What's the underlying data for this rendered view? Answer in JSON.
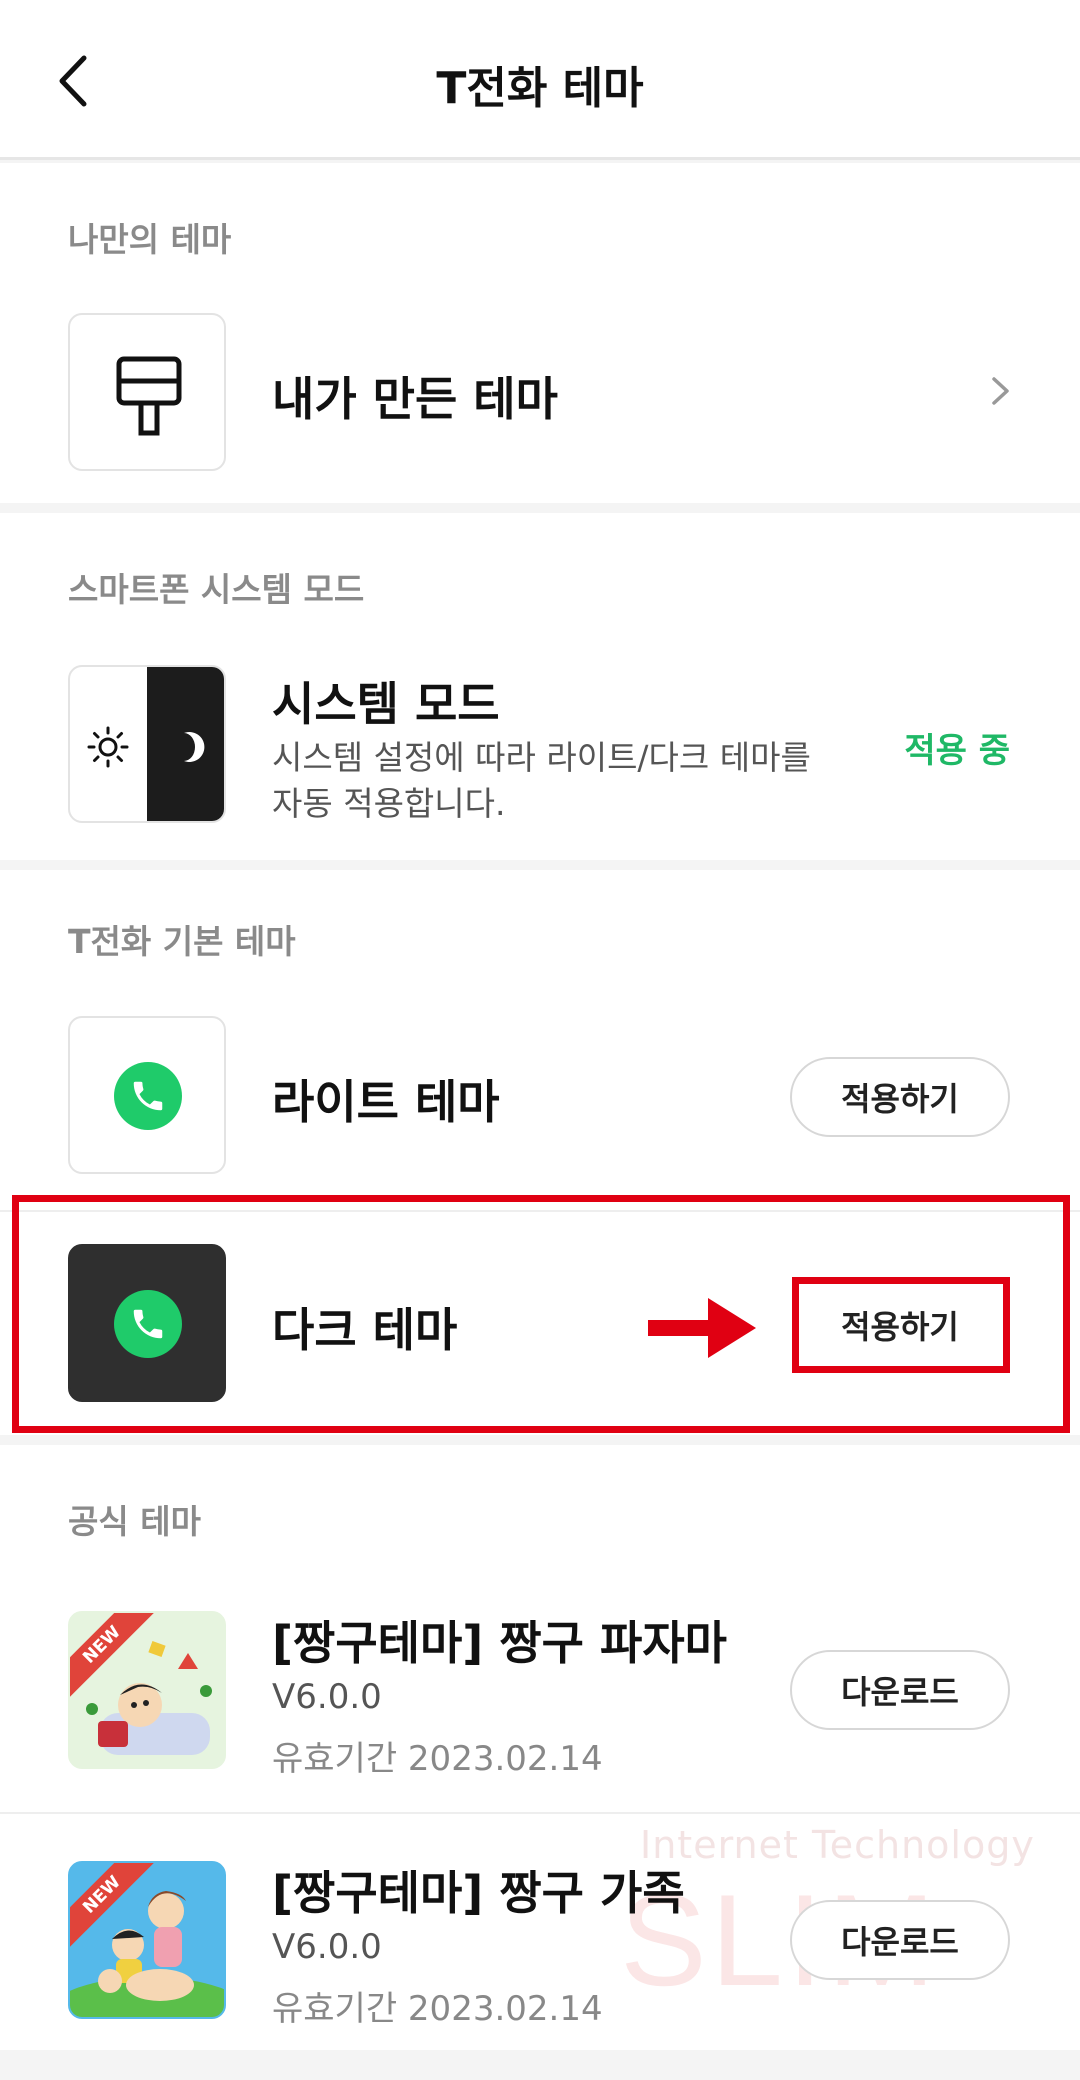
{
  "header": {
    "title": "T전화 테마"
  },
  "my_theme": {
    "label": "나만의 테마",
    "item": {
      "title": "내가 만든 테마"
    }
  },
  "system": {
    "label": "스마트폰 시스템 모드",
    "item": {
      "title": "시스템 모드",
      "desc_line1": "시스템 설정에 따라 라이트/다크 테마를",
      "desc_line2": "자동 적용합니다.",
      "status": "적용 중"
    }
  },
  "basic": {
    "label": "T전화 기본 테마",
    "items": [
      {
        "title": "라이트 테마",
        "button": "적용하기"
      },
      {
        "title": "다크 테마",
        "button": "적용하기"
      }
    ]
  },
  "official": {
    "label": "공식 테마",
    "items": [
      {
        "title": "[짱구테마] 짱구 파자마",
        "version": "V6.0.0",
        "expiry": "유효기간 2023.02.14",
        "button": "다운로드",
        "badge": "NEW"
      },
      {
        "title": "[짱구테마] 짱구 가족",
        "version": "V6.0.0",
        "expiry": "유효기간 2023.02.14",
        "button": "다운로드",
        "badge": "NEW"
      }
    ]
  },
  "watermark": {
    "line1": "Internet Technology",
    "line2": "SLIM"
  },
  "colors": {
    "accent_green": "#1fb866",
    "call_green": "#1fcb6a",
    "highlight_red": "#e00012"
  }
}
